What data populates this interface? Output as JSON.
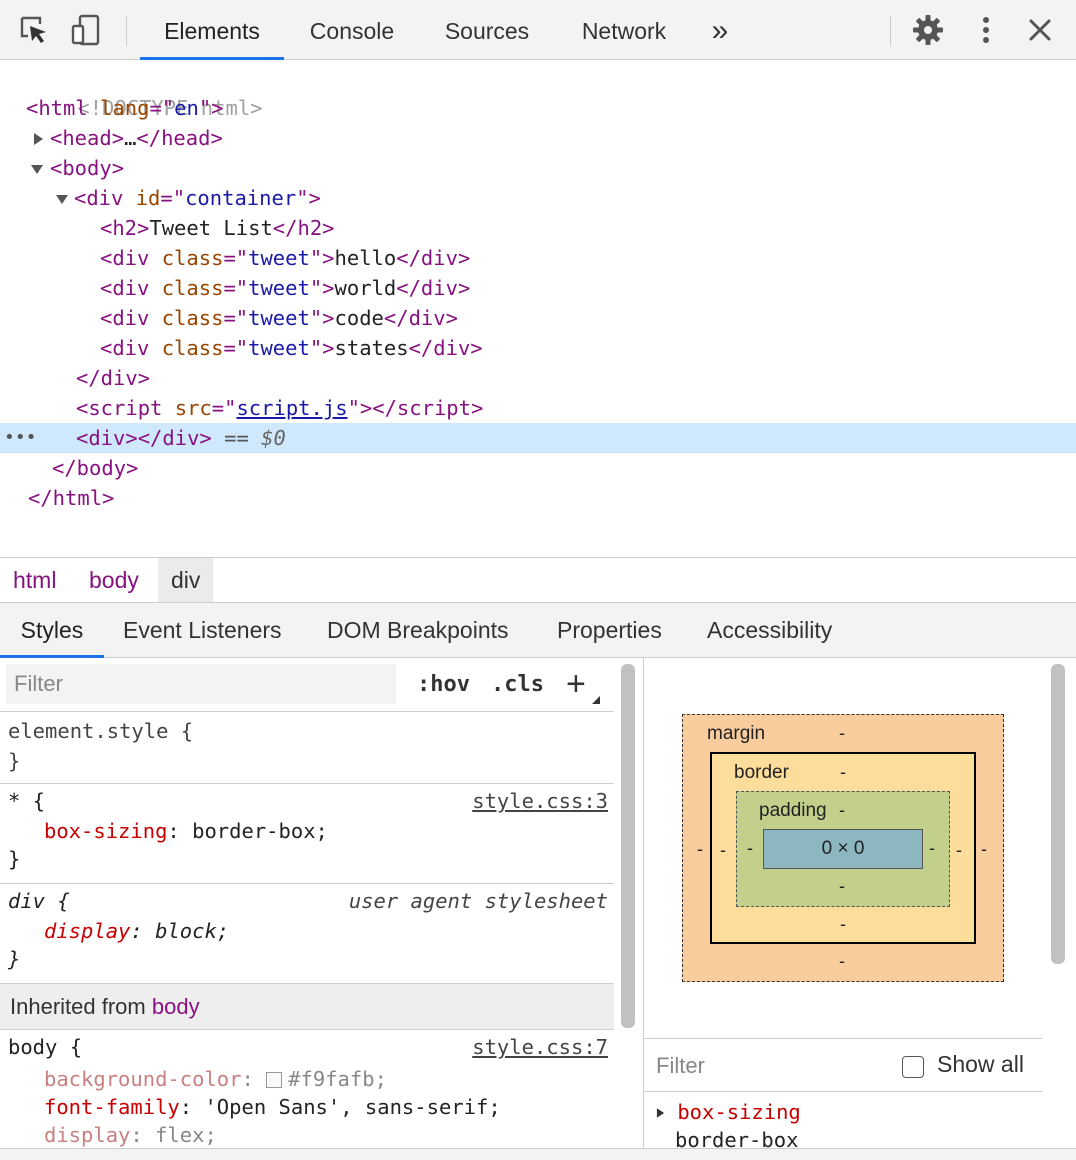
{
  "toolbar": {
    "tabs": [
      {
        "label": "Elements"
      },
      {
        "label": "Console"
      },
      {
        "label": "Sources"
      },
      {
        "label": "Network"
      }
    ],
    "more": "»"
  },
  "dom": {
    "doctype": "<!DOCTYPE html>",
    "lines": {
      "html_open": {
        "tag": "html",
        "attr": "lang",
        "val": "en"
      },
      "head": {
        "open": "<head>",
        "ellipsis": "…",
        "close": "</head>"
      },
      "body_open": "<body>",
      "div_container": {
        "tag": "div",
        "attr": "id",
        "val": "container"
      },
      "h2": {
        "open": "<h2>",
        "text": "Tweet List",
        "close": "</h2>"
      },
      "tweets": [
        {
          "attr": "class",
          "val": "tweet",
          "text": "hello"
        },
        {
          "attr": "class",
          "val": "tweet",
          "text": "world"
        },
        {
          "attr": "class",
          "val": "tweet",
          "text": "code"
        },
        {
          "attr": "class",
          "val": "tweet",
          "text": "states"
        }
      ],
      "div_close": "</div>",
      "script": {
        "attr": "src",
        "val": "script.js"
      },
      "selected": {
        "markup": "<div></div>",
        "suffix": " == ",
        "ref": "$0"
      },
      "body_close": "</body>",
      "html_close": "</html>"
    }
  },
  "breadcrumbs": [
    "html",
    "body",
    "div"
  ],
  "subtabs": [
    "Styles",
    "Event Listeners",
    "DOM Breakpoints",
    "Properties",
    "Accessibility"
  ],
  "styles": {
    "filter_placeholder": "Filter",
    "hov": ":hov",
    "cls": ".cls",
    "plus": "+",
    "element_style": {
      "selector": "element.style {",
      "close": "}"
    },
    "universal": {
      "selector": "* {",
      "source": "style.css:3",
      "props": [
        {
          "name": "box-sizing",
          "value": "border-box;"
        }
      ],
      "close": "}"
    },
    "div_ua": {
      "selector": "div {",
      "source": "user agent stylesheet",
      "props": [
        {
          "name": "display",
          "value": "block;"
        }
      ],
      "close": "}"
    },
    "inherited": {
      "label": "Inherited from",
      "tag": "body"
    },
    "body_rule": {
      "selector": "body {",
      "source": "style.css:7",
      "props": [
        {
          "name": "background-color",
          "value": "#f9fafb;",
          "swatch": "#f9fafb"
        },
        {
          "name": "font-family",
          "value": "'Open Sans', sans-serif;"
        },
        {
          "name": "display",
          "value": "flex;"
        }
      ]
    }
  },
  "box_model": {
    "margin_label": "margin",
    "border_label": "border",
    "padding_label": "padding",
    "dash": "-",
    "content": "0 × 0"
  },
  "computed": {
    "filter_placeholder": "Filter",
    "show_all": "Show all",
    "property": "box-sizing",
    "value": "border-box"
  },
  "colors": {
    "accent": "#1a73e8",
    "selected_row": "#cfe8fc",
    "tag": "#881280",
    "attr": "#994500",
    "attr_value": "#1a1aa6",
    "css_prop": "#c80000",
    "margin": "#f9cc9d",
    "border": "#fddd9b",
    "padding": "#c3d08b",
    "content": "#8cb6c0"
  }
}
